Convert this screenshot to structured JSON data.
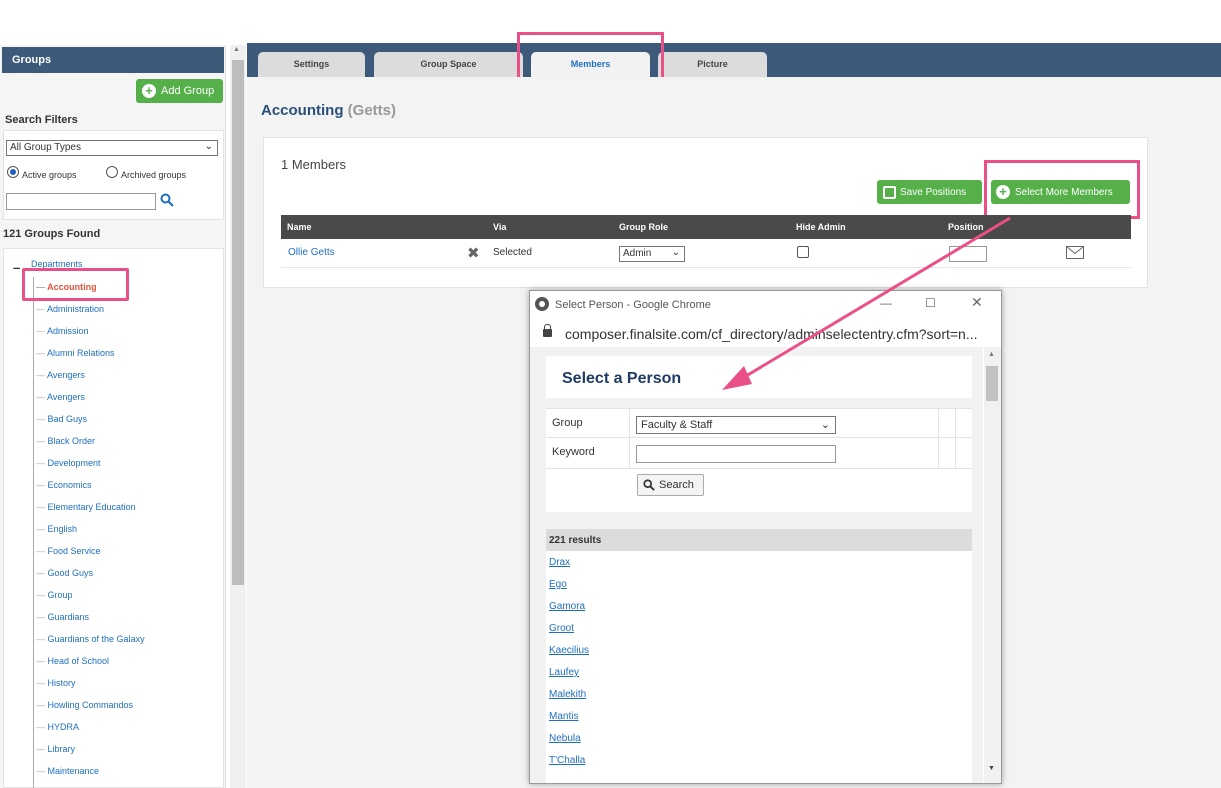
{
  "sidebar": {
    "title": "Groups",
    "add_group_label": "Add Group",
    "search_filters_label": "Search Filters",
    "group_type_selected": "All Group Types",
    "radio_active_label": "Active groups",
    "radio_archived_label": "Archived groups",
    "groups_found": "121 Groups Found",
    "tree_root": "Departments",
    "tree_items": [
      "Accounting",
      "Administration",
      "Admission",
      "Alumni Relations",
      "Avengers",
      "Avengers",
      "Bad Guys",
      "Black Order",
      "Development",
      "Economics",
      "Elementary Education",
      "English",
      "Food Service",
      "Good Guys",
      "Group",
      "Guardians",
      "Guardians of the Galaxy",
      "Head of School",
      "History",
      "Howling Commandos",
      "HYDRA",
      "Library",
      "Maintenance"
    ],
    "selected_item": "Accounting"
  },
  "tabs": [
    "Settings",
    "Group Space",
    "Members",
    "Picture"
  ],
  "active_tab": "Members",
  "group": {
    "name": "Accounting",
    "owner": "(Getts)"
  },
  "members": {
    "count_label": "1 Members",
    "save_positions_label": "Save Positions",
    "select_more_label": "Select More Members",
    "columns": [
      "Name",
      "Via",
      "Group Role",
      "Hide Admin",
      "Position"
    ],
    "rows": [
      {
        "name": "Ollie Getts",
        "via": "Selected",
        "role": "Admin",
        "hide_admin": false,
        "position": ""
      }
    ]
  },
  "popup": {
    "window_title": "Select Person - Google Chrome",
    "url": "composer.finalsite.com/cf_directory/adminselectentry.cfm?sort=n...",
    "heading": "Select a Person",
    "group_label": "Group",
    "group_selected": "Faculty & Staff",
    "keyword_label": "Keyword",
    "keyword_value": "",
    "search_label": "Search",
    "results_count": "221 results",
    "results": [
      "Drax",
      "Ego",
      "Gamora",
      "Groot",
      "Kaecilius",
      "Laufey",
      "Malekith",
      "Mantis",
      "Nebula",
      "T'Challa"
    ]
  },
  "colors": {
    "header_navy": "#3e5a7a",
    "button_green": "#56b04a",
    "highlight_pink": "#ea4f88",
    "link_blue": "#1f6fbf"
  }
}
